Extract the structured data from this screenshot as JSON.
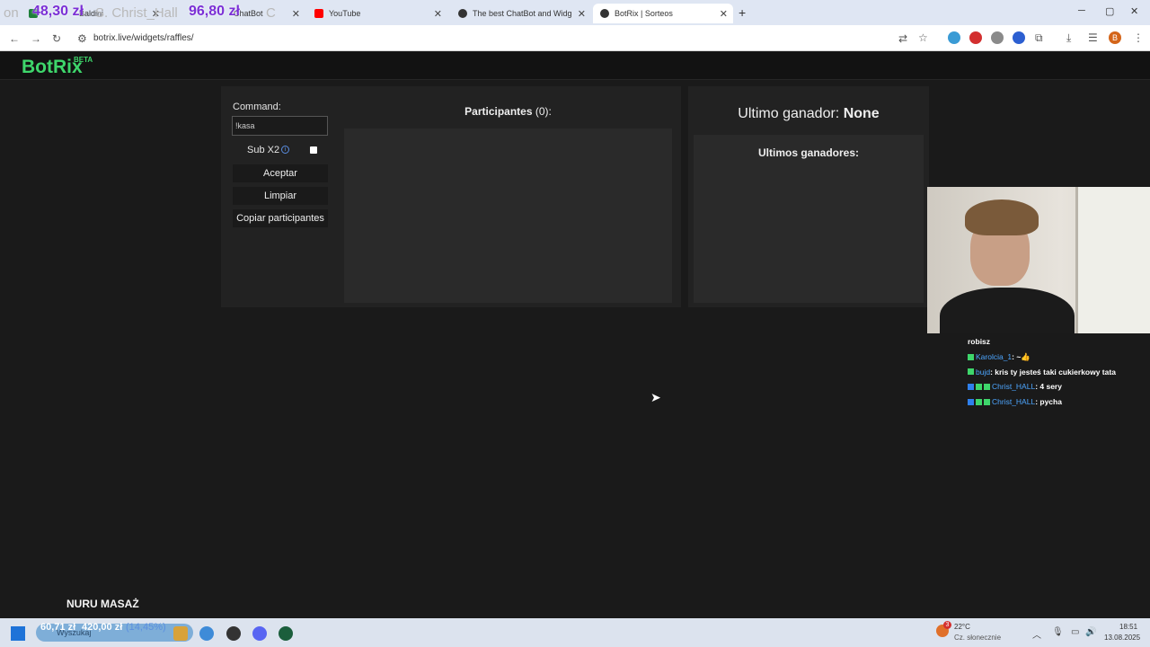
{
  "browser": {
    "tabs": [
      {
        "label": "Baldini",
        "favicon_color": "#1e7f3a"
      },
      {
        "label": "ChatBot",
        "favicon_color": "#444444"
      },
      {
        "label": "YouTube",
        "favicon_color": "#ff0000"
      },
      {
        "label": "The best ChatBot and Widgets",
        "favicon_color": "#333333"
      },
      {
        "label": "BotRix | Sorteos",
        "favicon_color": "#333333",
        "active": true
      }
    ],
    "url": "botrix.live/widgets/raffles/",
    "new_tab_glyph": "+",
    "close_glyph": "✕"
  },
  "stream_overlay": {
    "amount_1": "48,30 zł",
    "name": "S. Christ_Hall",
    "amount_2": "96,80 zł",
    "prefix": "on",
    "suffix": "C"
  },
  "site": {
    "brand": "BotRix",
    "beta": "BETA"
  },
  "raffle": {
    "command_label": "Command:",
    "command_value": "!kasa",
    "sub_label": "Sub X2",
    "sub_checked": false,
    "accept_label": "Aceptar",
    "clear_label": "Limpiar",
    "copy_label": "Copiar participantes",
    "participants_label": "Participantes",
    "participants_count": "(0):",
    "last_winner_label": "Ultimo ganador:",
    "last_winner_value": "None",
    "last_winners_label": "Ultimos ganadores:"
  },
  "chat": [
    {
      "user": "",
      "message": "robisz"
    },
    {
      "user": "Karolcia_1",
      "message": ": ~👍"
    },
    {
      "user": "bujd",
      "message": ": kris ty jesteś taki cukierkowy tata"
    },
    {
      "user": "Christ_HALL",
      "message": ": 4 sery"
    },
    {
      "user": "Christ_HALL",
      "message": ": pycha"
    }
  ],
  "overlay_bottom": "NURU MASAŻ",
  "taskbar": {
    "search_placeholder": "Wyszukaj",
    "price_1": "60,71 zł",
    "price_2": "420,00 zł",
    "price_3": "(14,45%)",
    "notif_count": "3",
    "weather_temp": "22°C",
    "weather_desc": "Cz. słonecznie",
    "time": "18:51",
    "date": "13.08.2025"
  }
}
